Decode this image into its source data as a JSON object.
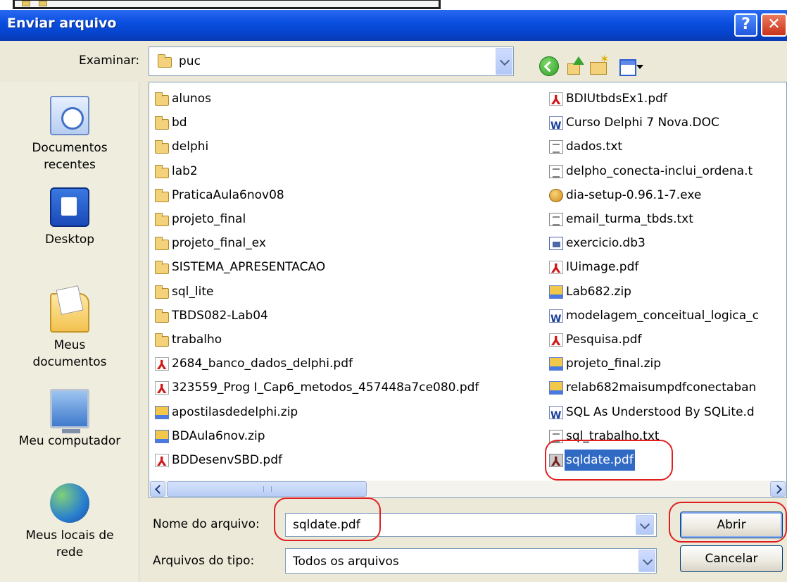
{
  "window": {
    "title": "Enviar arquivo",
    "help_symbol": "?",
    "close_symbol": "✕"
  },
  "look_in": {
    "label": "Examinar:",
    "value": "puc",
    "icon": "folder-icon"
  },
  "toolbar": {
    "icons": [
      "back-icon",
      "up-folder-icon",
      "new-folder-icon",
      "views-menu-icon"
    ]
  },
  "places": [
    {
      "label": "Documentos recentes",
      "icon": "recent-documents-icon"
    },
    {
      "label": "Desktop",
      "icon": "desktop-icon"
    },
    {
      "label": "Meus documentos",
      "icon": "my-documents-icon"
    },
    {
      "label": "Meu computador",
      "icon": "my-computer-icon"
    },
    {
      "label": "Meus locais de rede",
      "icon": "network-places-icon"
    }
  ],
  "files_col1": [
    {
      "name": "alunos",
      "type": "folder"
    },
    {
      "name": "bd",
      "type": "folder"
    },
    {
      "name": "delphi",
      "type": "folder"
    },
    {
      "name": "lab2",
      "type": "folder"
    },
    {
      "name": "PraticaAula6nov08",
      "type": "folder"
    },
    {
      "name": "projeto_final",
      "type": "folder"
    },
    {
      "name": "projeto_final_ex",
      "type": "folder"
    },
    {
      "name": "SISTEMA_APRESENTACAO",
      "type": "folder"
    },
    {
      "name": "sql_lite",
      "type": "folder"
    },
    {
      "name": "TBDS082-Lab04",
      "type": "folder"
    },
    {
      "name": "trabalho",
      "type": "folder"
    },
    {
      "name": "2684_banco_dados_delphi.pdf",
      "type": "pdf"
    },
    {
      "name": "323559_Prog I_Cap6_metodos_457448a7ce080.pdf",
      "type": "pdf"
    },
    {
      "name": "apostilasdedelphi.zip",
      "type": "zip"
    },
    {
      "name": "BDAula6nov.zip",
      "type": "zip"
    },
    {
      "name": "BDDesenvSBD.pdf",
      "type": "pdf"
    }
  ],
  "files_col2": [
    {
      "name": "BDIUtbdsEx1.pdf",
      "type": "pdf"
    },
    {
      "name": "Curso Delphi 7 Nova.DOC",
      "type": "doc"
    },
    {
      "name": "dados.txt",
      "type": "txt"
    },
    {
      "name": "delpho_conecta-inclui_ordena.t",
      "type": "txt"
    },
    {
      "name": "dia-setup-0.96.1-7.exe",
      "type": "exe"
    },
    {
      "name": "email_turma_tbds.txt",
      "type": "txt"
    },
    {
      "name": "exercicio.db3",
      "type": "db"
    },
    {
      "name": "IUimage.pdf",
      "type": "pdf"
    },
    {
      "name": "Lab682.zip",
      "type": "zip"
    },
    {
      "name": "modelagem_conceitual_logica_c",
      "type": "doc"
    },
    {
      "name": "Pesquisa.pdf",
      "type": "pdf"
    },
    {
      "name": "projeto_final.zip",
      "type": "zip"
    },
    {
      "name": "relab682maisumpdfconectaban",
      "type": "zip"
    },
    {
      "name": "SQL As Understood By SQLite.d",
      "type": "doc"
    },
    {
      "name": "sql_trabalho.txt",
      "type": "txt"
    },
    {
      "name": "sqldate.pdf",
      "type": "pdf",
      "selected": true
    }
  ],
  "filename": {
    "label": "Nome do arquivo:",
    "value": "sqldate.pdf"
  },
  "filetype": {
    "label": "Arquivos do tipo:",
    "value": "Todos os arquivos"
  },
  "buttons": {
    "open": "Abrir",
    "cancel": "Cancelar"
  },
  "highlight_color": "#e02020",
  "selection_color": "#316ac5"
}
